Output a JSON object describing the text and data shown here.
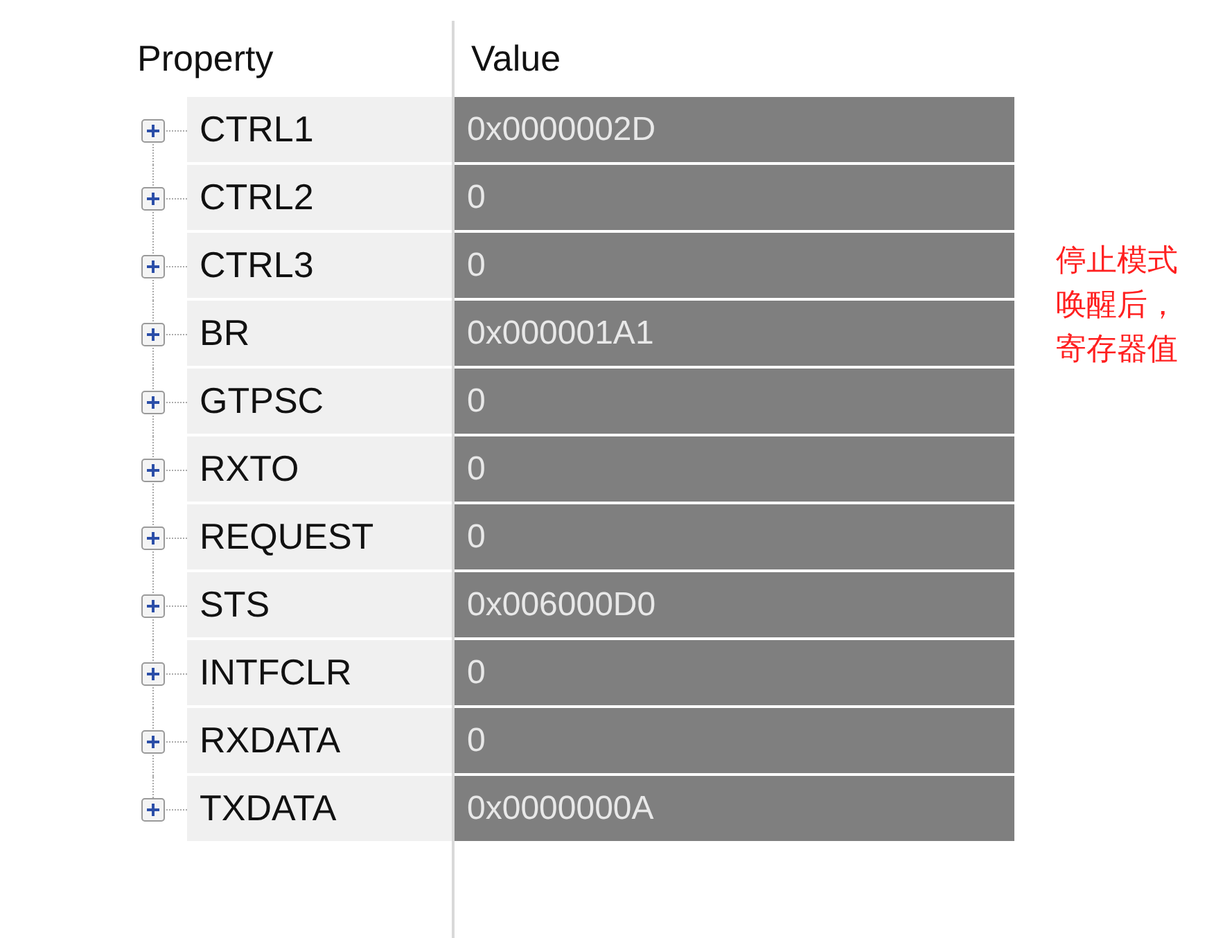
{
  "columns": [
    "Property",
    "Value"
  ],
  "rows": [
    {
      "name": "CTRL1",
      "value": "0x0000002D",
      "expanded": false
    },
    {
      "name": "CTRL2",
      "value": "0",
      "expanded": false
    },
    {
      "name": "CTRL3",
      "value": "0",
      "expanded": false
    },
    {
      "name": "BR",
      "value": "0x000001A1",
      "expanded": false
    },
    {
      "name": "GTPSC",
      "value": "0",
      "expanded": false
    },
    {
      "name": "RXTO",
      "value": "0",
      "expanded": false
    },
    {
      "name": "REQUEST",
      "value": "0",
      "expanded": false
    },
    {
      "name": "STS",
      "value": "0x006000D0",
      "expanded": false
    },
    {
      "name": "INTFCLR",
      "value": "0",
      "expanded": false
    },
    {
      "name": "RXDATA",
      "value": "0",
      "expanded": false
    },
    {
      "name": "TXDATA",
      "value": "0x0000000A",
      "expanded": false
    }
  ],
  "note_lines": [
    "停止模式",
    "唤醒后，",
    "寄存器值"
  ]
}
